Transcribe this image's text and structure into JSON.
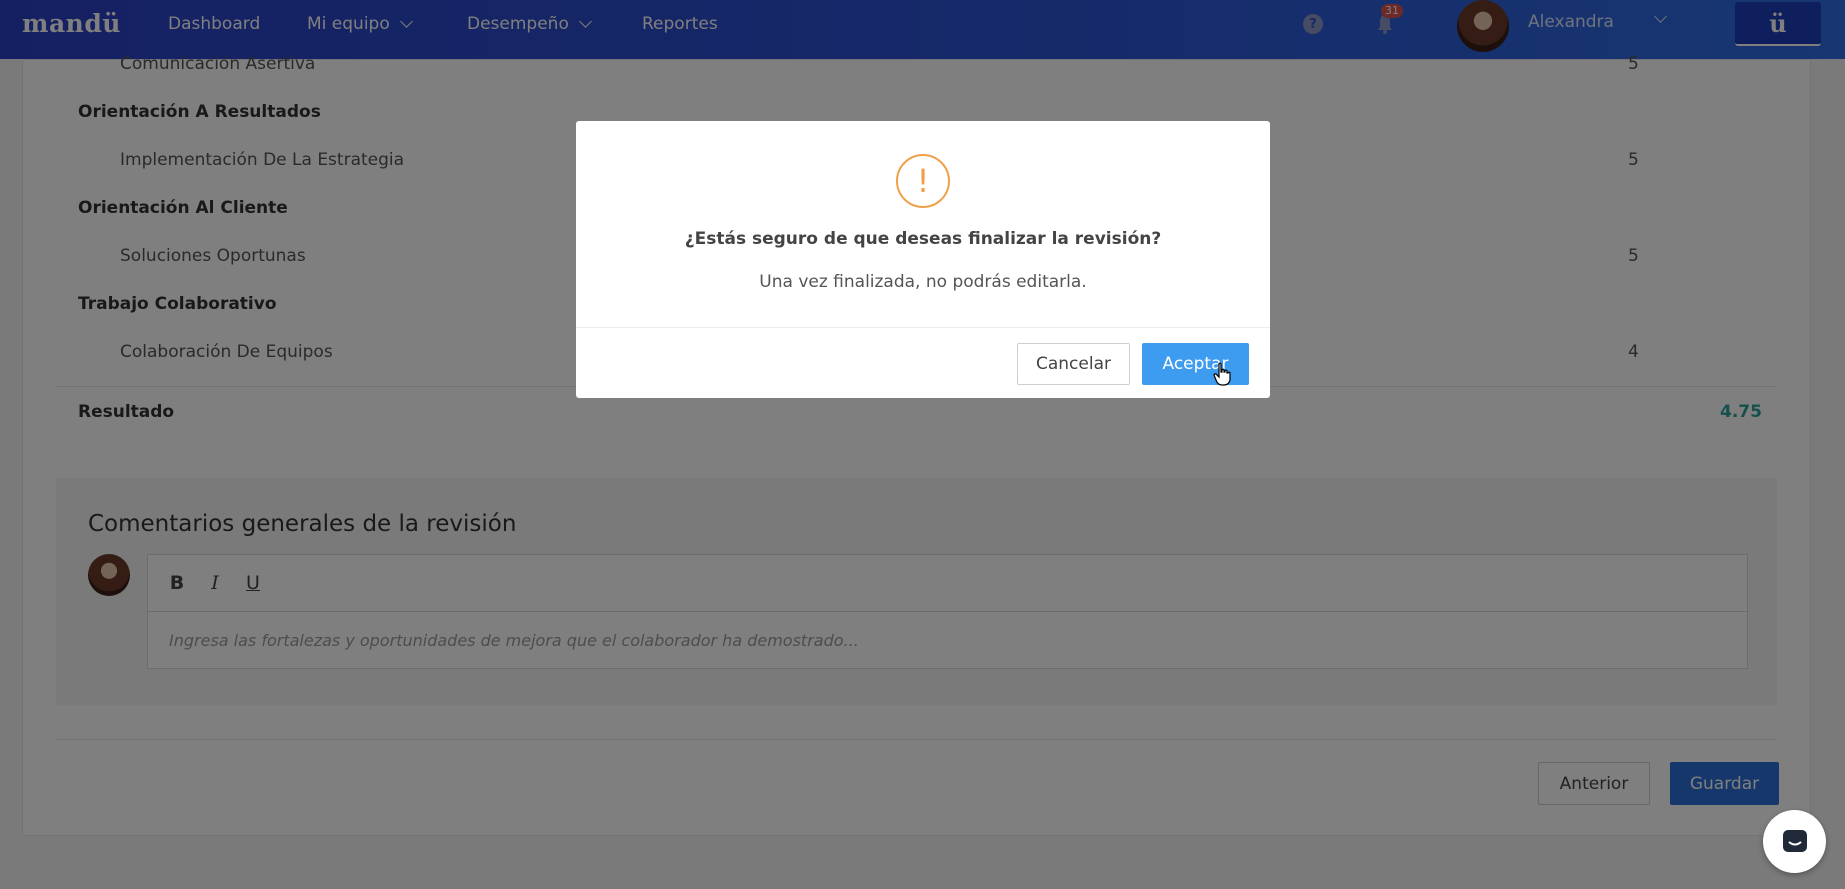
{
  "navbar": {
    "logo": "mandü",
    "items": [
      {
        "label": "Dashboard"
      },
      {
        "label": "Mi equipo"
      },
      {
        "label": "Desempeño"
      },
      {
        "label": "Reportes"
      }
    ],
    "help_glyph": "?",
    "notifications_count": "31",
    "user_name": "Alexandra",
    "brand_button": "ü"
  },
  "competencies": {
    "rows": [
      {
        "label": "Comunicación Asertiva",
        "score": "5"
      },
      {
        "label": "Orientación A Resultados"
      },
      {
        "label": "Implementación De La Estrategia",
        "score": "5"
      },
      {
        "label": "Orientación Al Cliente"
      },
      {
        "label": "Soluciones Oportunas",
        "score": "5"
      },
      {
        "label": "Trabajo Colaborativo"
      },
      {
        "label": "Colaboración De Equipos",
        "score": "4"
      }
    ],
    "result_label": "Resultado",
    "result_value": "4.75"
  },
  "comments": {
    "title": "Comentarios generales de la revisión",
    "toolbar": {
      "bold": "B",
      "italic": "I",
      "underline": "U"
    },
    "placeholder": "Ingresa las fortalezas y oportunidades de mejora que el colaborador ha demostrado..."
  },
  "footer": {
    "prev_label": "Anterior",
    "save_label": "Guardar"
  },
  "modal": {
    "icon_glyph": "!",
    "title": "¿Estás seguro de que deseas finalizar la revisión?",
    "message": "Una vez finalizada, no podrás editarla.",
    "cancel_label": "Cancelar",
    "accept_label": "Aceptar"
  },
  "colors": {
    "navbar": "#2c55d6",
    "accent": "#3d9cf0",
    "warning": "#f0a04b",
    "result": "#2aa198"
  }
}
